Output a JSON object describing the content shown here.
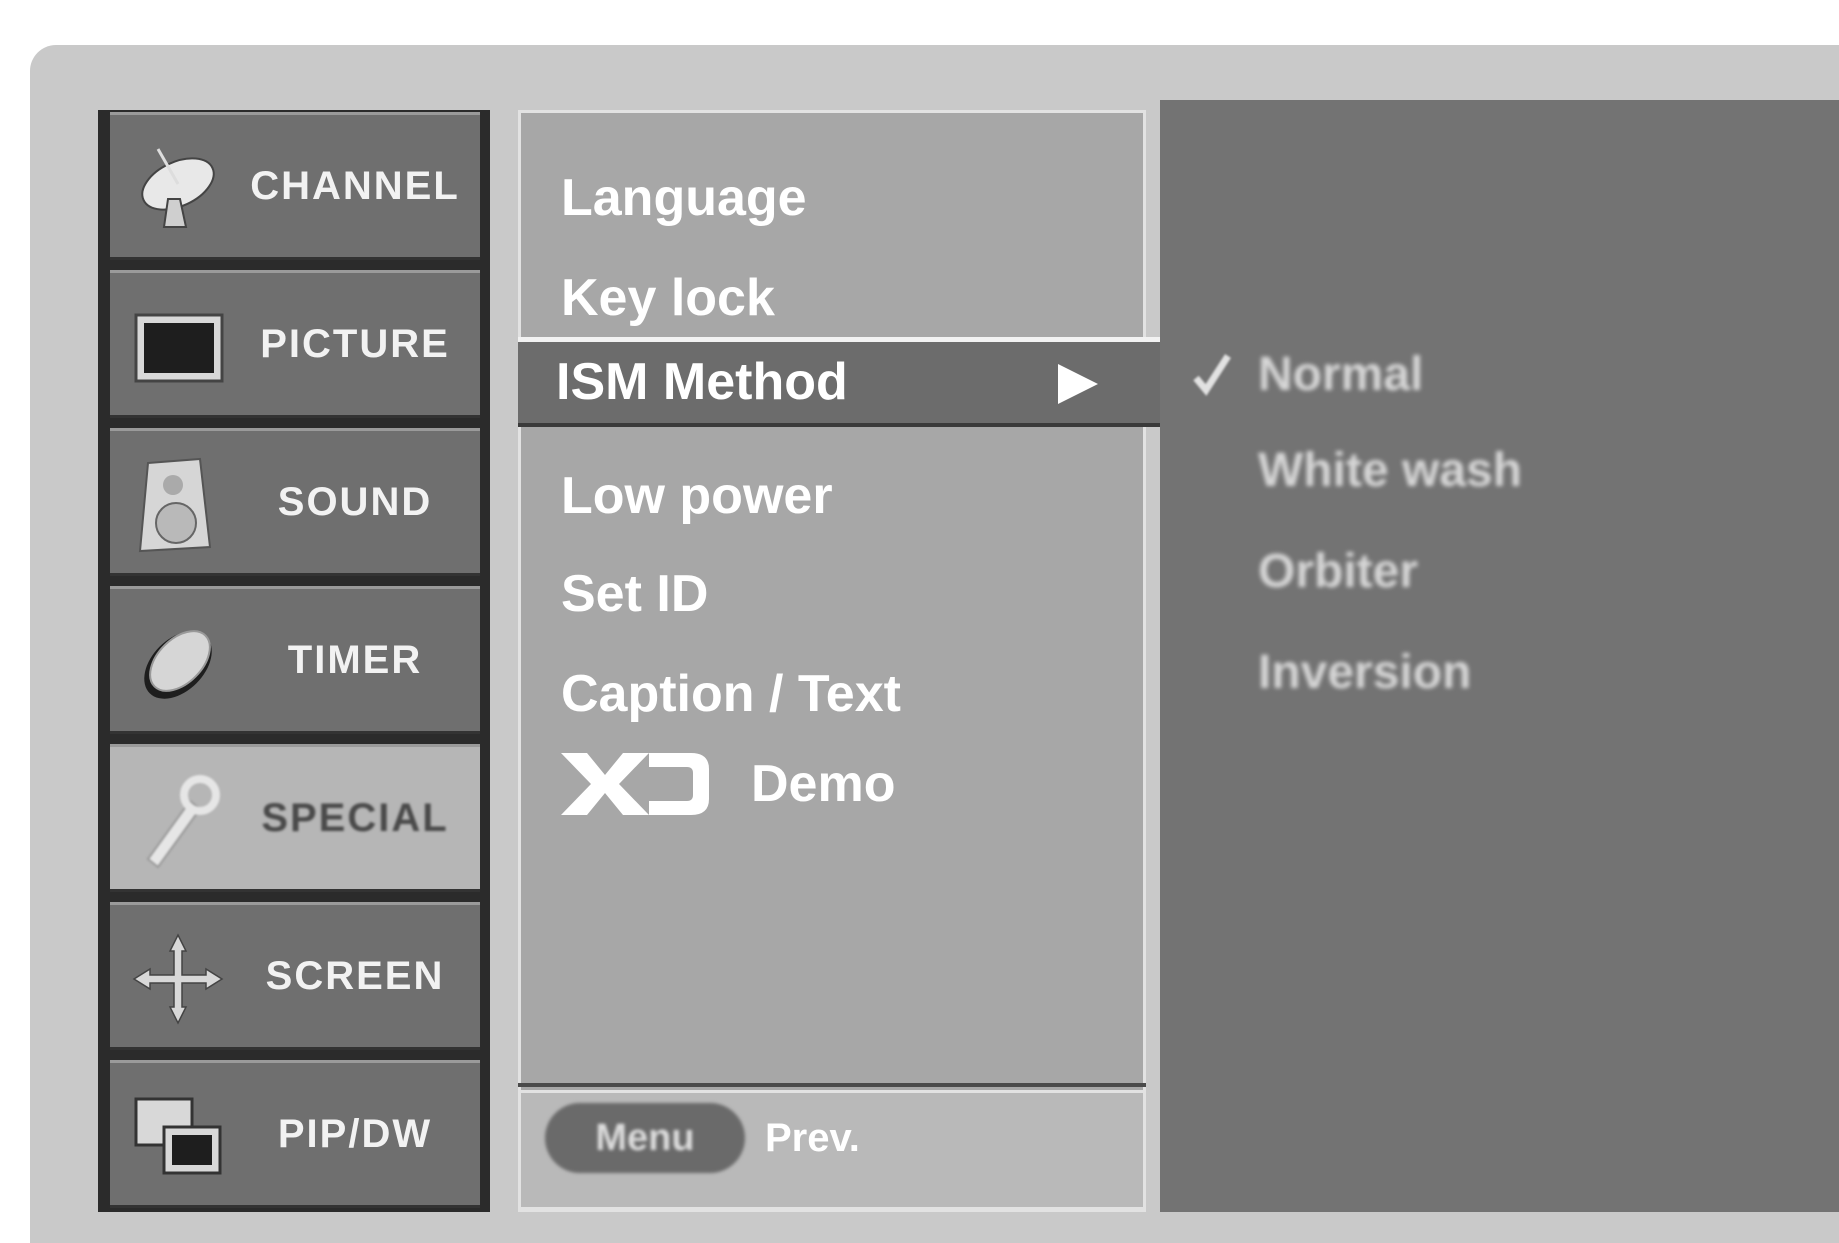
{
  "categories": [
    {
      "label": "CHANNEL",
      "icon": "satellite-dish-icon"
    },
    {
      "label": "PICTURE",
      "icon": "tv-screen-icon"
    },
    {
      "label": "SOUND",
      "icon": "speaker-icon"
    },
    {
      "label": "TIMER",
      "icon": "clock-icon"
    },
    {
      "label": "SPECIAL",
      "icon": "wrench-icon",
      "active": true
    },
    {
      "label": "SCREEN",
      "icon": "move-arrows-icon"
    },
    {
      "label": "PIP/DW",
      "icon": "pip-windows-icon"
    }
  ],
  "menu": {
    "items": [
      "Language",
      "Key lock",
      "ISM Method",
      "Low power",
      "Set ID",
      "Caption / Text"
    ],
    "selected_index": 2,
    "demo_logo": "XD",
    "demo_label": "Demo"
  },
  "submenu": {
    "options": [
      "Normal",
      "White wash",
      "Orbiter",
      "Inversion"
    ],
    "checked_index": 0
  },
  "footer": {
    "menu_button": "Menu",
    "prev_label": "Prev."
  },
  "colors": {
    "frame": "#c9c9c9",
    "menu_panel": "#a7a7a7",
    "selection": "#6c6c6c",
    "options_panel": "#737373"
  }
}
